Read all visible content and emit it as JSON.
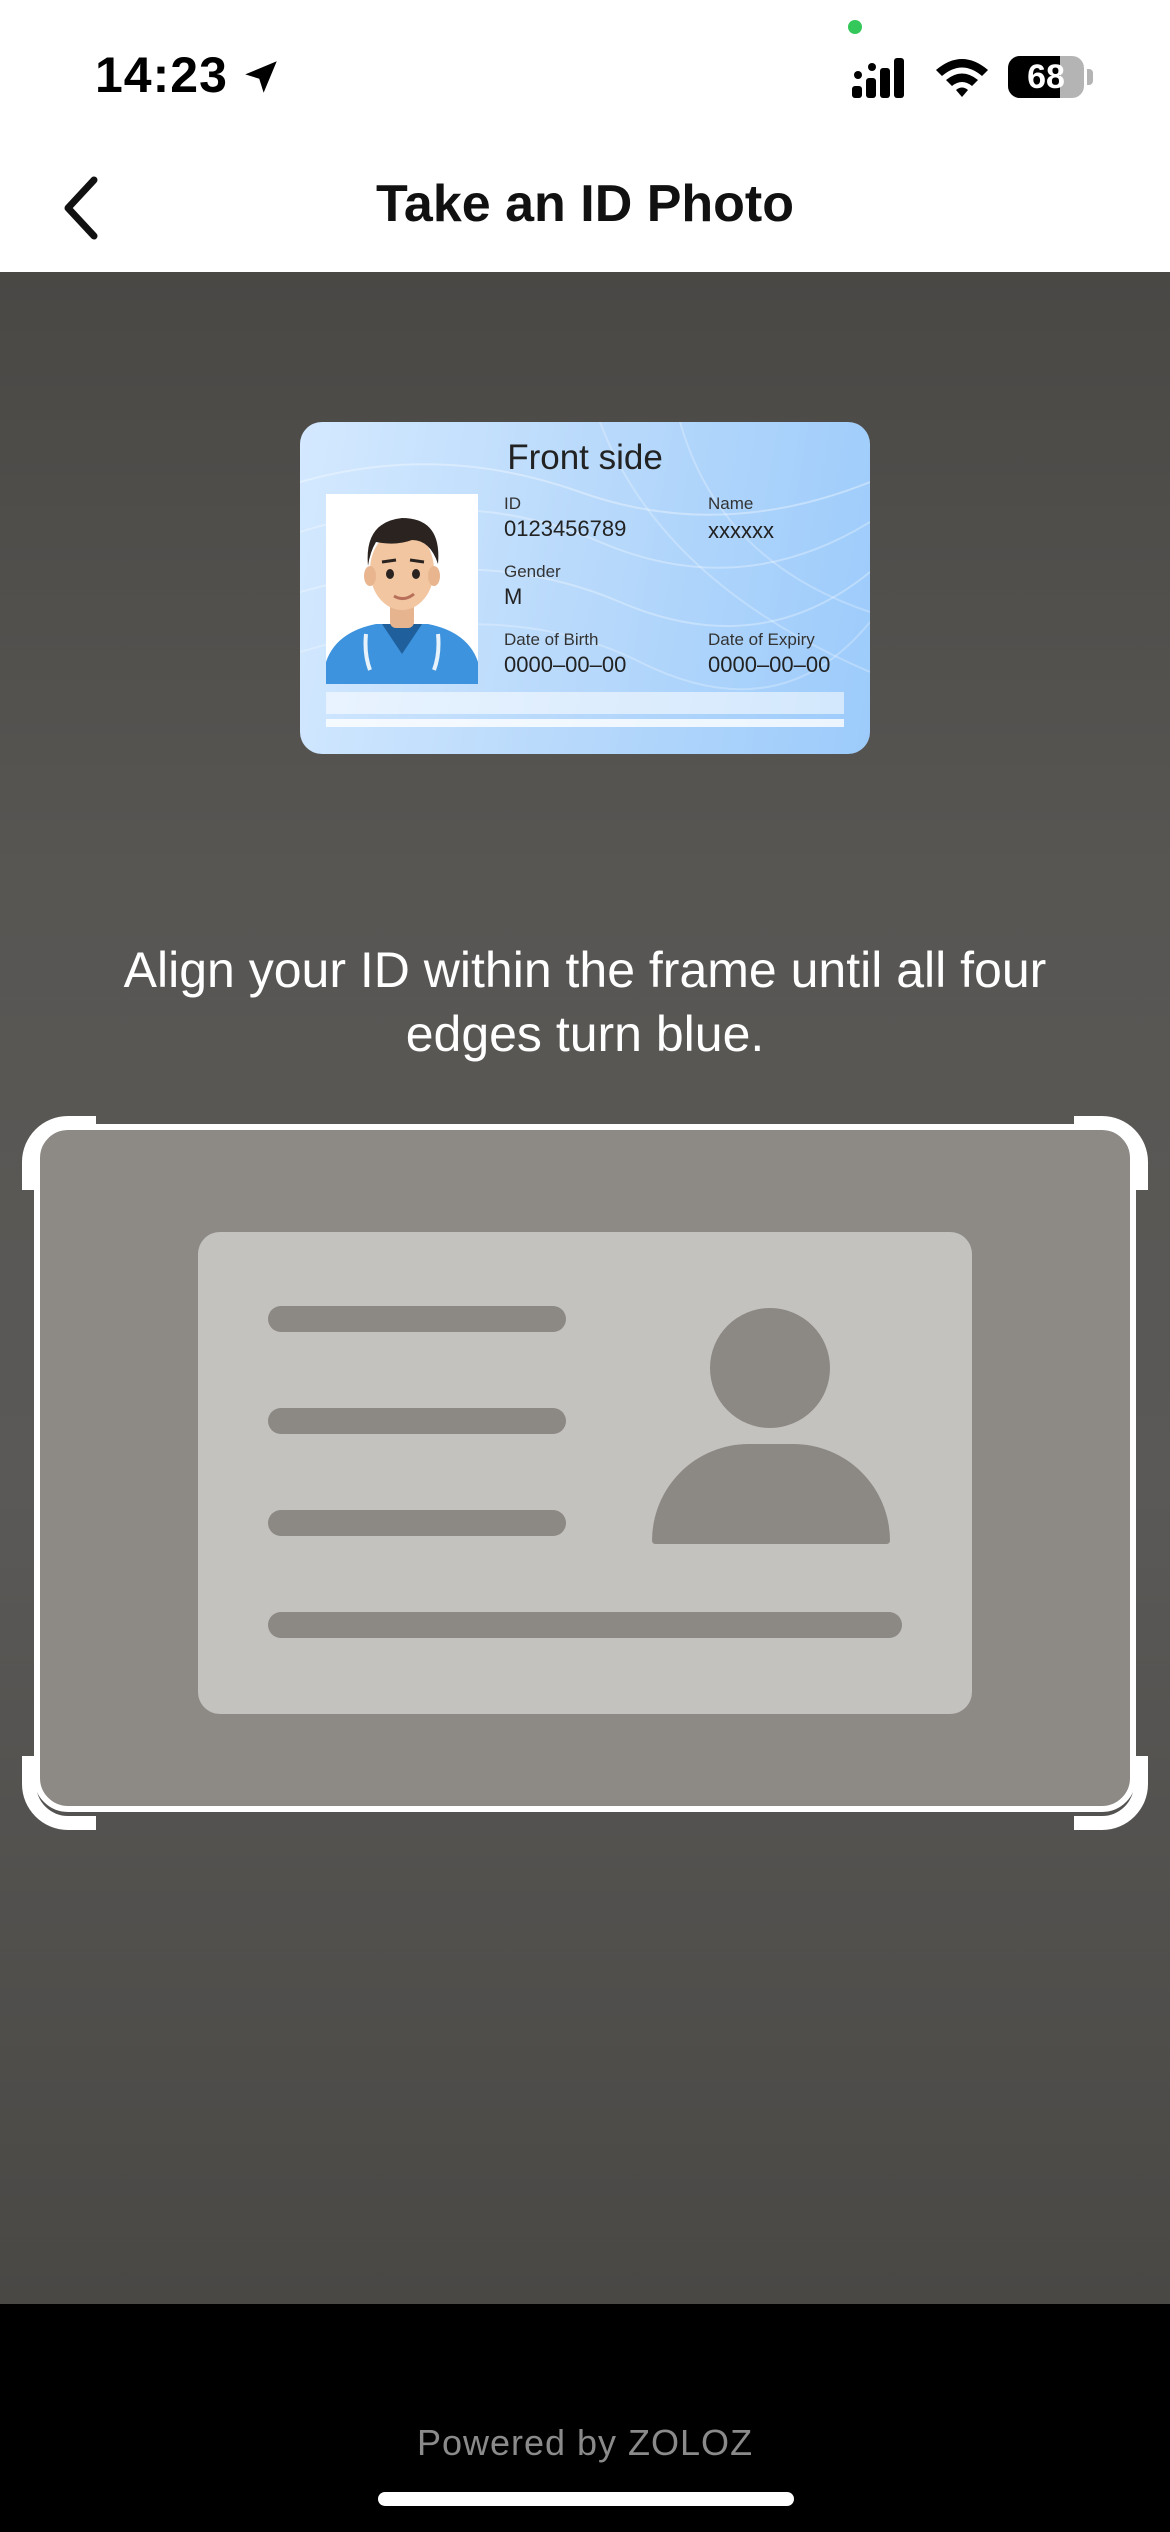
{
  "status_bar": {
    "time": "14:23",
    "battery_level": "68",
    "battery_fraction": 0.68,
    "icons": [
      "location-arrow-icon",
      "signal-icon",
      "wifi-icon",
      "battery-icon"
    ]
  },
  "nav": {
    "back_icon": "chevron-left-icon",
    "title": "Take an ID Photo"
  },
  "sample_card": {
    "title": "Front side",
    "id_label": "ID",
    "id_value": "0123456789",
    "name_label": "Name",
    "name_value": "xxxxxx",
    "gender_label": "Gender",
    "gender_value": "M",
    "dob_label": "Date of Birth",
    "dob_value": "0000–00–00",
    "expiry_label": "Date of Expiry",
    "expiry_value": "0000–00–00"
  },
  "instruction": "Align your ID within the frame until all four edges turn blue.",
  "footer": {
    "powered_by": "Powered by ZOLOZ"
  },
  "colors": {
    "frame": "#ffffff",
    "camera_background": "#585653",
    "card_gradient_start": "#d4e9ff",
    "card_gradient_end": "#9ccbfb"
  }
}
